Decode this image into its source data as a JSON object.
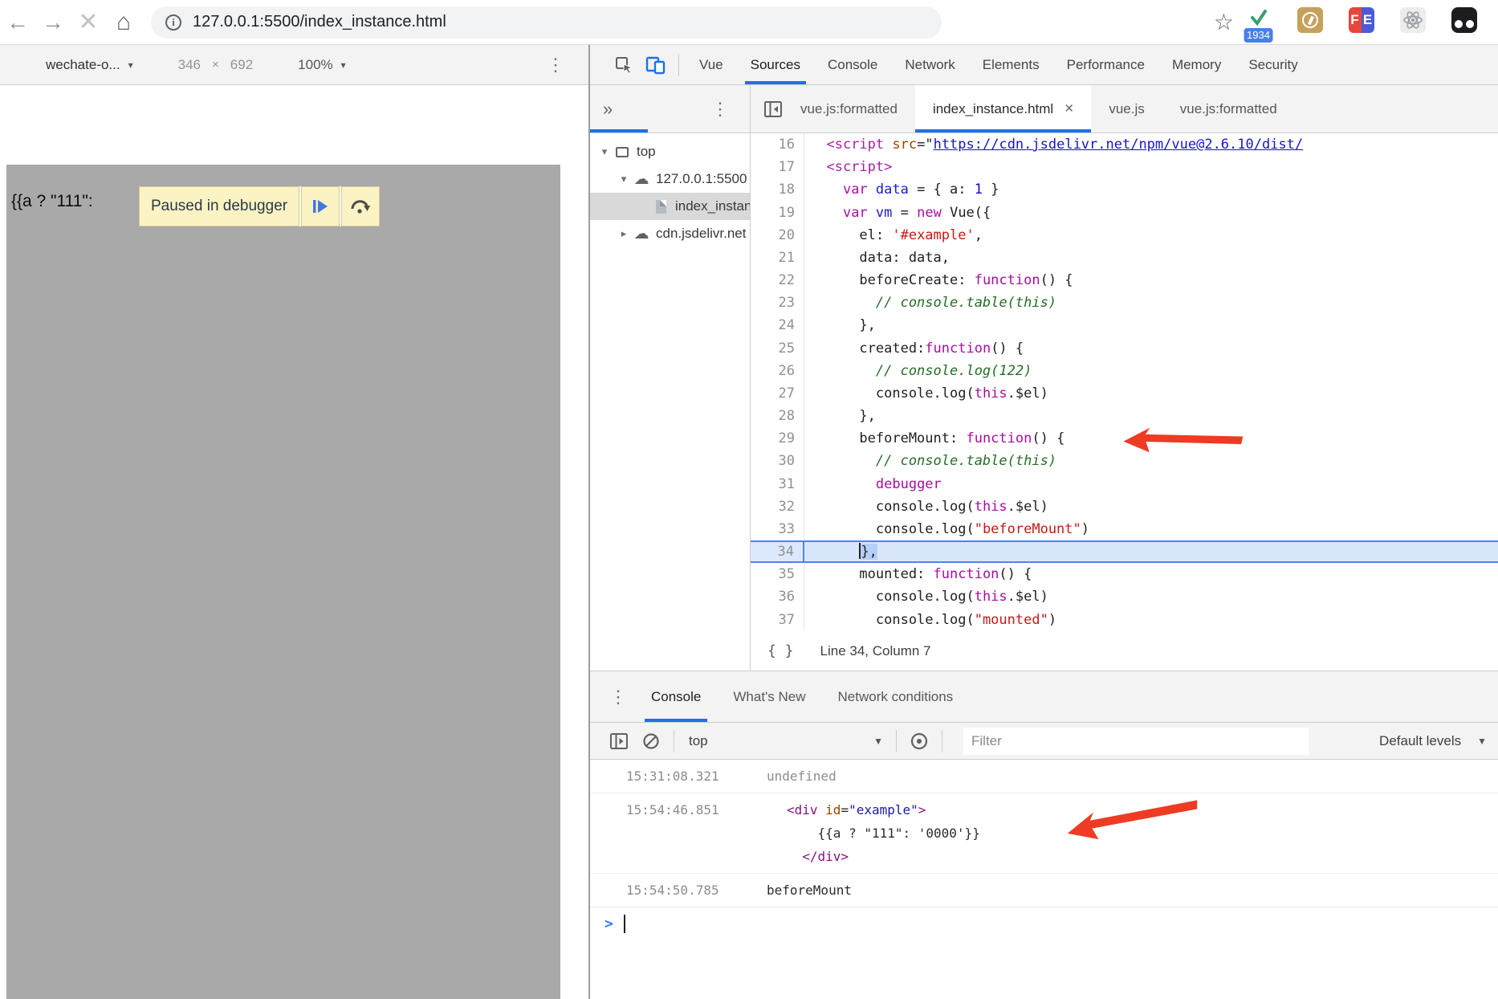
{
  "colors": {
    "accent_blue": "#1a73e8",
    "arrow_red": "#ee3b24",
    "paused_yellow": "#fbf3c3",
    "viewport_gray": "#a9a9a9"
  },
  "browser": {
    "url": "127.0.0.1:5500/index_instance.html",
    "extension_badge": "1934",
    "fe_left": "F",
    "fe_right": "E"
  },
  "device_toolbar": {
    "device": "wechate-o...",
    "width": "346",
    "separator": "×",
    "height": "692",
    "zoom": "100%"
  },
  "page": {
    "mustache": "{{a ? \"111\":",
    "paused_label": "Paused in debugger"
  },
  "devtools": {
    "tabs": [
      "Vue",
      "Sources",
      "Console",
      "Network",
      "Elements",
      "Performance",
      "Memory",
      "Security"
    ],
    "active_tab": "Sources",
    "file_tabs": [
      {
        "label": "vue.js:formatted"
      },
      {
        "label": "index_instance.html",
        "active": true,
        "closable": true
      },
      {
        "label": "vue.js"
      },
      {
        "label": "vue.js:formatted"
      }
    ],
    "navigator": {
      "items": [
        {
          "label": "top",
          "icon": "frame",
          "arrow": "down",
          "indent": 0
        },
        {
          "label": "127.0.0.1:5500",
          "icon": "cloud",
          "arrow": "down",
          "indent": 1
        },
        {
          "label": "index_instance.html",
          "icon": "file",
          "arrow": "none",
          "indent": 2,
          "selected": true
        },
        {
          "label": "cdn.jsdelivr.net",
          "icon": "cloud",
          "arrow": "right",
          "indent": 1
        }
      ]
    },
    "editor": {
      "status": "Line 34, Column 7",
      "lines": [
        {
          "n": 16,
          "t": [
            [
              "pln",
              "  "
            ],
            [
              "tag",
              "<script "
            ],
            [
              "attr",
              "src"
            ],
            [
              "pln",
              "=\""
            ],
            [
              "lnk",
              "https://cdn.jsdelivr.net/npm/vue@2.6.10/dist/"
            ]
          ]
        },
        {
          "n": 17,
          "t": [
            [
              "pln",
              "  "
            ],
            [
              "tag",
              "<script>"
            ]
          ]
        },
        {
          "n": 18,
          "t": [
            [
              "pln",
              "    "
            ],
            [
              "kw",
              "var"
            ],
            [
              "pln",
              " "
            ],
            [
              "def",
              "data"
            ],
            [
              "pln",
              " = { a: "
            ],
            [
              "num",
              "1"
            ],
            [
              "pln",
              " }"
            ]
          ]
        },
        {
          "n": 19,
          "t": [
            [
              "pln",
              "    "
            ],
            [
              "kw",
              "var"
            ],
            [
              "pln",
              " "
            ],
            [
              "def",
              "vm"
            ],
            [
              "pln",
              " = "
            ],
            [
              "kw",
              "new"
            ],
            [
              "pln",
              " Vue({"
            ]
          ]
        },
        {
          "n": 20,
          "t": [
            [
              "pln",
              "      el: "
            ],
            [
              "str",
              "'#example'"
            ],
            [
              "pln",
              ","
            ]
          ]
        },
        {
          "n": 21,
          "t": [
            [
              "pln",
              "      data: data,"
            ]
          ]
        },
        {
          "n": 22,
          "t": [
            [
              "pln",
              "      beforeCreate: "
            ],
            [
              "kw",
              "function"
            ],
            [
              "pln",
              "() {"
            ]
          ]
        },
        {
          "n": 23,
          "t": [
            [
              "cmt",
              "        // console.table(this)"
            ]
          ]
        },
        {
          "n": 24,
          "t": [
            [
              "pln",
              "      },"
            ]
          ]
        },
        {
          "n": 25,
          "t": [
            [
              "pln",
              "      created:"
            ],
            [
              "kw",
              "function"
            ],
            [
              "pln",
              "() {"
            ]
          ]
        },
        {
          "n": 26,
          "t": [
            [
              "cmt",
              "        // console.log(122)"
            ]
          ]
        },
        {
          "n": 27,
          "t": [
            [
              "pln",
              "        console.log("
            ],
            [
              "kw",
              "this"
            ],
            [
              "pln",
              ".$el)"
            ]
          ]
        },
        {
          "n": 28,
          "t": [
            [
              "pln",
              "      },"
            ]
          ]
        },
        {
          "n": 29,
          "t": [
            [
              "pln",
              "      beforeMount: "
            ],
            [
              "kw",
              "function"
            ],
            [
              "pln",
              "() {"
            ]
          ]
        },
        {
          "n": 30,
          "t": [
            [
              "cmt",
              "        // console.table(this)"
            ]
          ]
        },
        {
          "n": 31,
          "t": [
            [
              "pln",
              "        "
            ],
            [
              "kw",
              "debugger"
            ]
          ]
        },
        {
          "n": 32,
          "t": [
            [
              "pln",
              "        console.log("
            ],
            [
              "kw",
              "this"
            ],
            [
              "pln",
              ".$el)"
            ]
          ]
        },
        {
          "n": 33,
          "t": [
            [
              "pln",
              "        console.log("
            ],
            [
              "str",
              "\"beforeMount\""
            ],
            [
              "pln",
              ")"
            ]
          ]
        },
        {
          "n": 34,
          "a": true,
          "t": [
            [
              "pln",
              "      "
            ],
            [
              "xsel",
              "},"
            ]
          ]
        },
        {
          "n": 35,
          "t": [
            [
              "pln",
              "      mounted: "
            ],
            [
              "kw",
              "function"
            ],
            [
              "pln",
              "() {"
            ]
          ]
        },
        {
          "n": 36,
          "t": [
            [
              "pln",
              "        console.log("
            ],
            [
              "kw",
              "this"
            ],
            [
              "pln",
              ".$el)"
            ]
          ]
        },
        {
          "n": 37,
          "t": [
            [
              "pln",
              "        console.log("
            ],
            [
              "str",
              "\"mounted\""
            ],
            [
              "pln",
              ")"
            ]
          ]
        }
      ]
    },
    "drawer": {
      "tabs": [
        "Console",
        "What's New",
        "Network conditions"
      ],
      "active_tab": "Console"
    },
    "console": {
      "context": "top",
      "filter_placeholder": "Filter",
      "levels_label": "Default levels",
      "messages": [
        {
          "time": "15:31:08.321",
          "lines": [
            [
              [
                "gray",
                "undefined"
              ]
            ]
          ]
        },
        {
          "time": "15:54:46.851",
          "indent": true,
          "lines": [
            [
              [
                "tag",
                "<div "
              ],
              [
                "attr",
                "id"
              ],
              [
                "pln",
                "="
              ],
              [
                "val",
                "\"example\""
              ],
              [
                "tag",
                ">"
              ]
            ],
            [
              [
                "pln",
                "    {{a ? \"111\": '0000'}}"
              ]
            ],
            [
              [
                "tag",
                "  </div>"
              ]
            ]
          ]
        },
        {
          "time": "15:54:50.785",
          "lines": [
            [
              [
                "pln",
                "beforeMount"
              ]
            ]
          ]
        }
      ]
    }
  }
}
